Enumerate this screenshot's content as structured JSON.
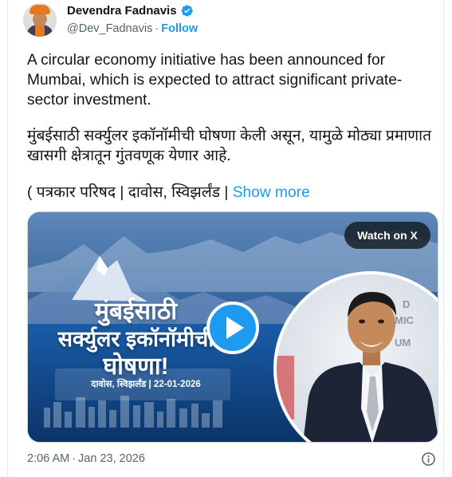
{
  "author": {
    "name": "Devendra Fadnavis",
    "handle": "@Dev_Fadnavis",
    "separator": "·",
    "follow_label": "Follow",
    "verified_icon": "verified-badge-icon",
    "verified_color": "#1d9bf0"
  },
  "tweet": {
    "text_en": "A circular economy initiative has been announced for Mumbai, which is expected to attract significant private-sector investment.",
    "text_mr": "मुंबईसाठी सर्क्युलर इकॉनॉमीची घोषणा केली असून, यामुळे मोठ्या प्रमाणात खासगी क्षेत्रातून गुंतवणूक येणार आहे.",
    "text_meta": "( पत्रकार परिषद | दावोस, स्विझर्लंड | ",
    "show_more": "Show more"
  },
  "media": {
    "watch_label": "Watch on X",
    "headline_line1": "मुंबईसाठी",
    "headline_line2": "सर्क्युलर इकॉनॉमीची",
    "headline_line3": "घोषणा!",
    "subline": "दावोस, स्विझर्लंड | 22-01-2026",
    "play_icon": "play-icon",
    "accent_color": "#1d9bf0"
  },
  "footer": {
    "time": "2:06 AM",
    "separator": "·",
    "date": "Jan 23, 2026",
    "info_icon": "info-icon"
  }
}
